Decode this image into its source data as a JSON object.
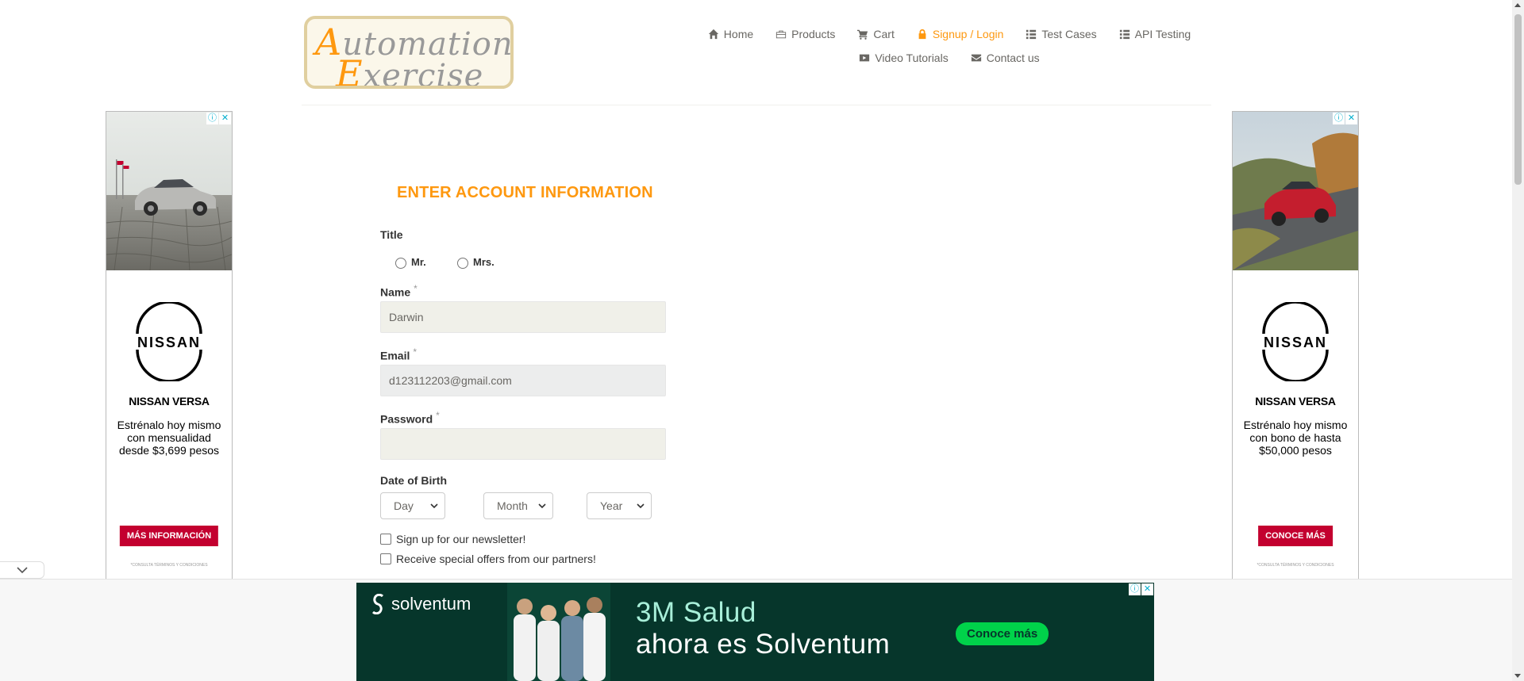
{
  "logo": {
    "line1_cap": "A",
    "line1_rest": "utomation",
    "line2_cap": "E",
    "line2_rest": "xercise"
  },
  "nav": {
    "row1": [
      {
        "label": "Home",
        "icon": "home-icon"
      },
      {
        "label": "Products",
        "icon": "briefcase-icon"
      },
      {
        "label": "Cart",
        "icon": "cart-icon"
      },
      {
        "label": "Signup / Login",
        "icon": "lock-icon",
        "active": true
      },
      {
        "label": "Test Cases",
        "icon": "list-icon"
      },
      {
        "label": "API Testing",
        "icon": "list-icon"
      }
    ],
    "row2": [
      {
        "label": "Video Tutorials",
        "icon": "youtube-icon"
      },
      {
        "label": "Contact us",
        "icon": "envelope-icon"
      }
    ]
  },
  "form": {
    "title": "ENTER ACCOUNT INFORMATION",
    "title_label": "Title",
    "mr": "Mr.",
    "mrs": "Mrs.",
    "name_label": "Name",
    "name_value": "Darwin",
    "email_label": "Email",
    "email_value": "d123112203@gmail.com",
    "password_label": "Password",
    "password_value": "",
    "required_mark": "*",
    "dob_label": "Date of Birth",
    "day": "Day",
    "month": "Month",
    "year": "Year",
    "newsletter": "Sign up for our newsletter!",
    "offers": "Receive special offers from our partners!"
  },
  "ads": {
    "left": {
      "title": "NISSAN VERSA",
      "text": "Estrénalo hoy mismo con mensualidad desde $3,699 pesos",
      "cta": "MÁS INFORMACIÓN",
      "fine": "*CONSULTA TÉRMINOS Y CONDICIONES",
      "brand": "NISSAN"
    },
    "right": {
      "title": "NISSAN VERSA",
      "text": "Estrénalo hoy mismo con bono de hasta $50,000 pesos",
      "cta": "CONOCE MÁS",
      "fine": "*CONSULTA TÉRMINOS Y CONDICIONES",
      "brand": "NISSAN"
    },
    "bottom": {
      "brand": "solventum",
      "line1": "3M Salud",
      "line2": "ahora es Solventum",
      "cta": "Conoce más"
    },
    "info_glyph": "ⓘ",
    "close_glyph": "✕"
  },
  "colors": {
    "accent": "#fe980f",
    "nissan_red": "#c3002f",
    "solventum_bg": "#06362b",
    "solventum_green": "#00d24a"
  }
}
